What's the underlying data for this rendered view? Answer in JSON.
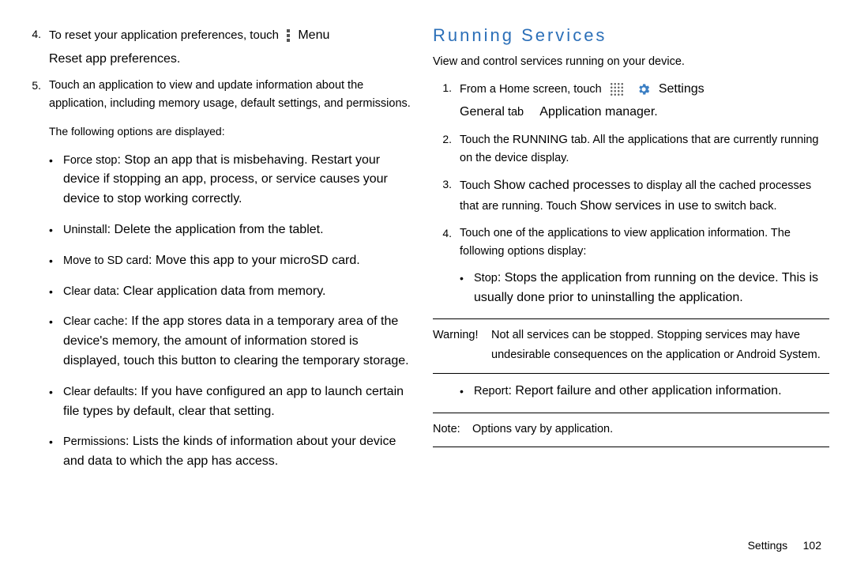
{
  "left": {
    "item4": {
      "num": "4.",
      "line1a": "To reset your application preferences, touch",
      "menu_label": "Menu",
      "line2": "Reset app preferences."
    },
    "item5": {
      "num": "5.",
      "text": "Touch an application to view and update information about the application, including memory usage, default settings, and permissions."
    },
    "follow": "The following options are displayed:",
    "bullets": [
      {
        "label": "Force stop",
        "text": ": Stop an app that is misbehaving. Restart your device if stopping an app, process, or service causes your device to stop working correctly."
      },
      {
        "label": "Uninstall",
        "text": ": Delete the application from the tablet."
      },
      {
        "label": "Move to SD card",
        "text": ": Move this app to your microSD card."
      },
      {
        "label": "Clear data",
        "text": ": Clear application data from memory."
      },
      {
        "label": "Clear cache",
        "text": ": If the app stores data in a temporary area of the device's memory, the amount of information stored is displayed, touch this button to clearing the temporary storage."
      },
      {
        "label": "Clear defaults",
        "text": ": If you have configured an app to launch certain file types by default, clear that setting."
      },
      {
        "label": "Permissions",
        "text": ": Lists the kinds of information about your device and data to which the app has access."
      }
    ]
  },
  "right": {
    "heading": "Running Services",
    "intro": "View and control services running on your device.",
    "item1": {
      "num": "1.",
      "pre": "From a Home screen, touch",
      "settings": "Settings",
      "line2a": "General",
      "line2b": "tab",
      "line2c": "Application manager."
    },
    "item2": {
      "num": "2.",
      "pre": "Touch the ",
      "running": "RUNNING",
      "post": " tab. All the applications that are currently running on the device display."
    },
    "item3": {
      "num": "3.",
      "a": "Touch ",
      "b": "Show cached processes",
      "c": " to display all the cached processes that are running. Touch ",
      "d": "Show services in use",
      "e": " to switch back."
    },
    "item4": {
      "num": "4.",
      "text": "Touch one of the applications to view application information. The following options display:"
    },
    "bullet_stop": {
      "label": "Stop",
      "text": ": Stops the application from running on the device. This is usually done prior to uninstalling the application."
    },
    "warning": {
      "label": "Warning!",
      "text": "Not all services can be stopped. Stopping services may have undesirable consequences on the application or Android System."
    },
    "bullet_report": {
      "label": "Report",
      "text": ": Report failure and other application information."
    },
    "note": {
      "label": "Note:",
      "text": "Options vary by application."
    }
  },
  "footer": {
    "section": "Settings",
    "page": "102"
  }
}
